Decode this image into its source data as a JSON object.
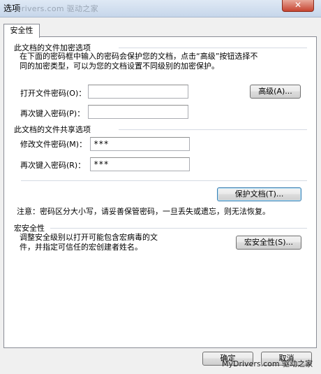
{
  "window": {
    "title": "选项",
    "close_symbol": "✕"
  },
  "watermark": {
    "top": "Drivers.com 驱动之家",
    "bottom": "MyDrivers.com 驱动之家"
  },
  "tabs": [
    {
      "label": "安全性",
      "active": true
    }
  ],
  "encryption": {
    "heading": "此文档的文件加密选项",
    "description_line1": "在下面的密码框中输入的密码会保护您的文档，点击“高级”按钮选择不",
    "description_line2": "同的加密类型，可以为您的文档设置不同级别的加密保护。",
    "open_password_label": "打开文件密码(O)：",
    "open_password_value": "",
    "reenter_label": "再次键入密码(P)：",
    "reenter_value": "",
    "advanced_button": "高级(A)..."
  },
  "sharing": {
    "heading": "此文档的文件共享选项",
    "modify_password_label": "修改文件密码(M)：",
    "modify_password_value": "***",
    "reenter_label": "再次键入密码(R)：",
    "reenter_value": "***",
    "protect_button": "保护文档(T)..."
  },
  "note": "注意：密码区分大小写，请妥善保管密码，一旦丢失或遗忘，则无法恢复。",
  "macro": {
    "heading": "宏安全性",
    "description_line1": "调整安全级别以打开可能包含宏病毒的文",
    "description_line2": "件，并指定可信任的宏创建者姓名。",
    "button": "宏安全性(S)..."
  },
  "footer": {
    "ok_button": "确定",
    "cancel_button": "取消"
  }
}
